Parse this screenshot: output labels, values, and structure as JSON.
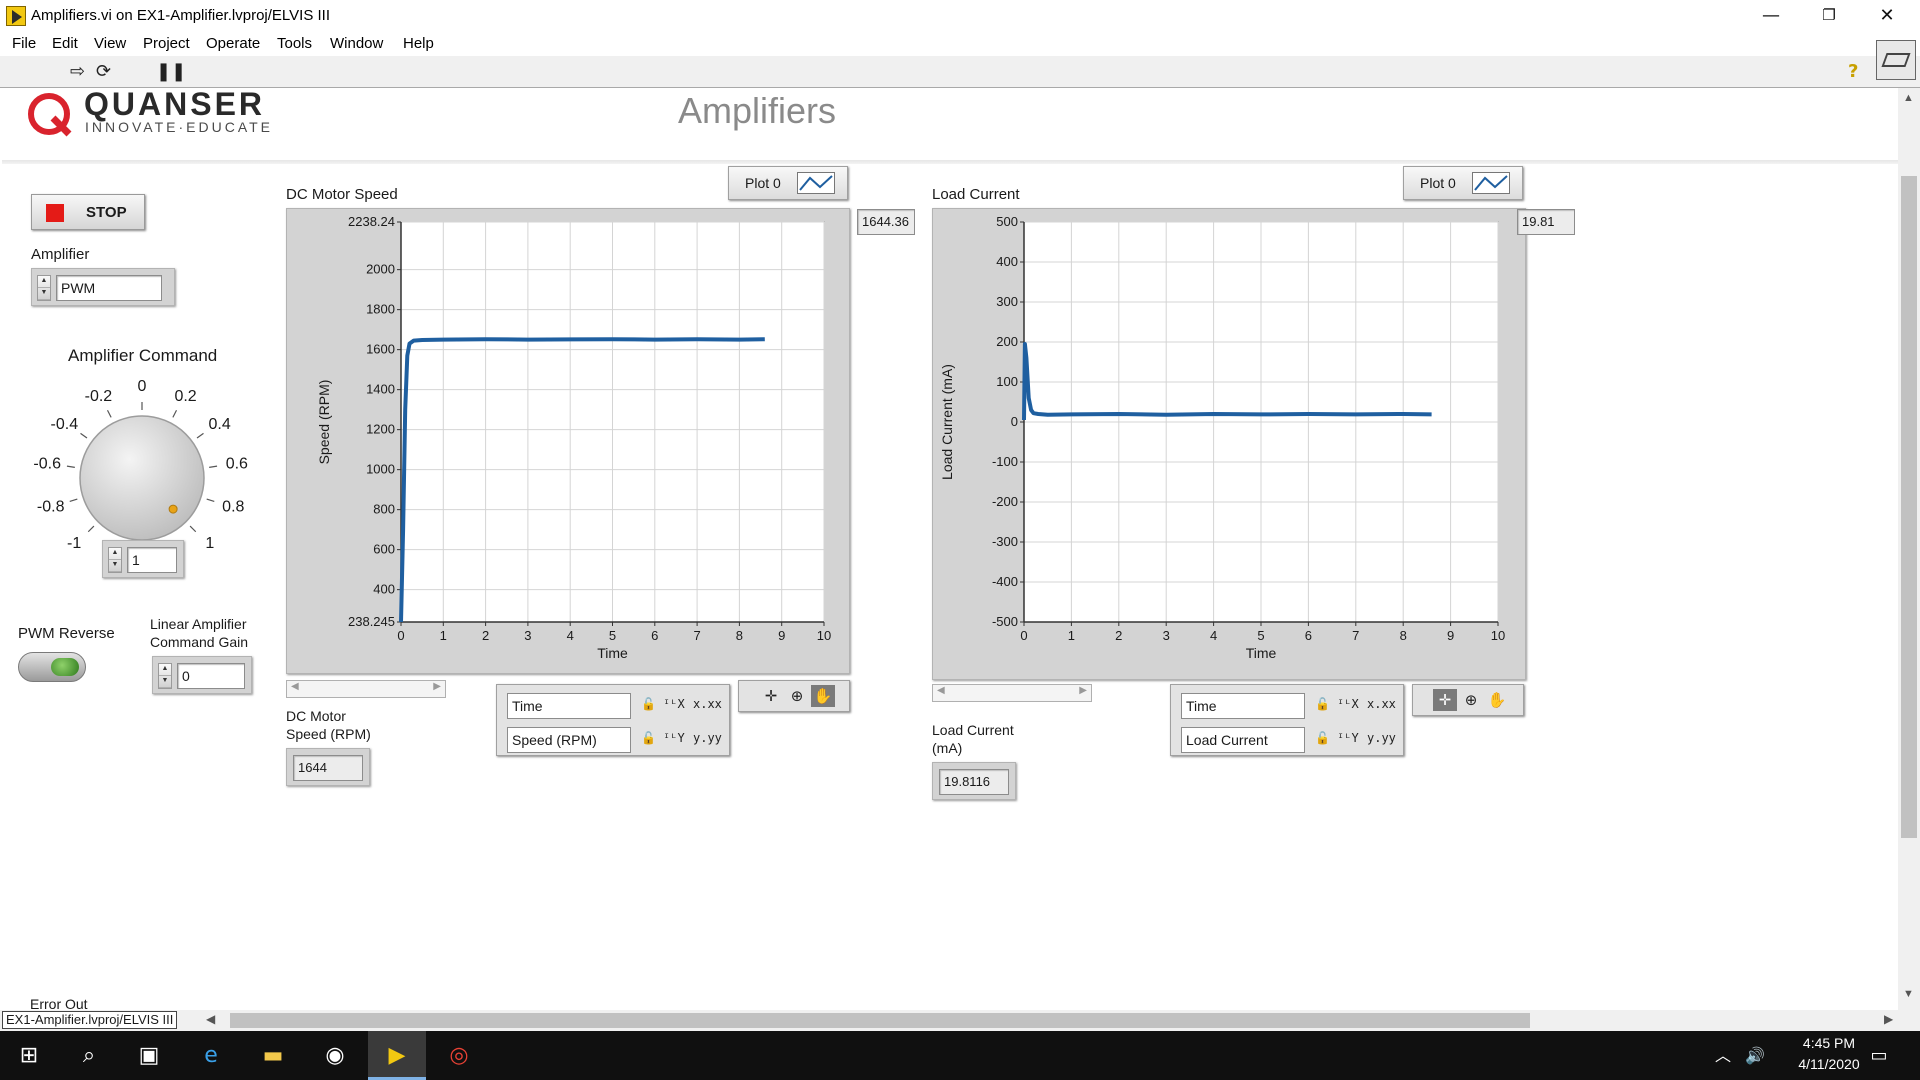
{
  "window": {
    "title": "Amplifiers.vi on EX1-Amplifier.lvproj/ELVIS III",
    "controls": {
      "minimize": "—",
      "restore": "❐",
      "close": "✕"
    }
  },
  "menu": [
    "File",
    "Edit",
    "View",
    "Project",
    "Operate",
    "Tools",
    "Window",
    "Help"
  ],
  "toolbar": {
    "run_icon": "run-arrow-icon",
    "continuous_icon": "run-continuously-icon",
    "pause_icon": "pause-icon",
    "help_icon": "context-help-icon"
  },
  "header": {
    "logo_brand": "QUANSER",
    "logo_tagline": "INNOVATE·EDUCATE",
    "title": "Amplifiers"
  },
  "controls": {
    "stop_label": "STOP",
    "amplifier_label": "Amplifier",
    "amplifier_value": "PWM",
    "command_label": "Amplifier Command",
    "command_value": "1",
    "knob_ticks": [
      "-1",
      "-0.8",
      "-0.6",
      "-0.4",
      "-0.2",
      "0",
      "0.2",
      "0.4",
      "0.6",
      "0.8",
      "1"
    ],
    "knob_value": 1,
    "pwm_reverse_label": "PWM Reverse",
    "linear_gain_label_1": "Linear Amplifier",
    "linear_gain_label_2": "Command Gain",
    "linear_gain_value": "0",
    "error_out_label": "Error Out"
  },
  "speed_chart": {
    "title": "DC Motor Speed",
    "legend_label": "Plot 0",
    "digital_display": "1644.36",
    "indicator_label_1": "DC Motor",
    "indicator_label_2": "Speed (RPM)",
    "indicator_value": "1644",
    "x_scale_name": "Time",
    "y_scale_name": "Speed (RPM)"
  },
  "current_chart": {
    "title": "Load Current",
    "legend_label": "Plot 0",
    "digital_display": "19.81",
    "indicator_label_1": "Load Current",
    "indicator_label_2": "(mA)",
    "indicator_value": "19.8116",
    "x_scale_name": "Time",
    "y_scale_name": "Load Current"
  },
  "chart_data": [
    {
      "type": "line",
      "title": "DC Motor Speed",
      "xlabel": "Time",
      "ylabel": "Speed (RPM)",
      "xlim": [
        0,
        10
      ],
      "ylim": [
        238.245,
        2238.24
      ],
      "x_ticks": [
        "0",
        "1",
        "2",
        "3",
        "4",
        "5",
        "6",
        "7",
        "8",
        "9",
        "10"
      ],
      "y_ticks": [
        {
          "value": 2238.24,
          "label": "2238.24"
        },
        {
          "value": 2000,
          "label": "2000"
        },
        {
          "value": 1800,
          "label": "1800"
        },
        {
          "value": 1600,
          "label": "1600"
        },
        {
          "value": 1400,
          "label": "1400"
        },
        {
          "value": 1200,
          "label": "1200"
        },
        {
          "value": 1000,
          "label": "1000"
        },
        {
          "value": 800,
          "label": "800"
        },
        {
          "value": 600,
          "label": "600"
        },
        {
          "value": 400,
          "label": "400"
        },
        {
          "value": 238.245,
          "label": "238.245"
        }
      ],
      "grid": true,
      "series": [
        {
          "color": "#1f5fa0",
          "x": [
            0,
            0.05,
            0.1,
            0.15,
            0.2,
            0.3,
            0.5,
            1,
            2,
            3,
            4,
            5,
            6,
            7,
            8,
            8.6
          ],
          "y": [
            238.245,
            700,
            1300,
            1570,
            1630,
            1645,
            1648,
            1650,
            1652,
            1650,
            1651,
            1652,
            1650,
            1652,
            1650,
            1652
          ]
        }
      ]
    },
    {
      "type": "line",
      "title": "Load Current",
      "xlabel": "Time",
      "ylabel": "Load Current (mA)",
      "xlim": [
        0,
        10
      ],
      "ylim": [
        -500,
        500
      ],
      "x_ticks": [
        "0",
        "1",
        "2",
        "3",
        "4",
        "5",
        "6",
        "7",
        "8",
        "9",
        "10"
      ],
      "y_ticks": [
        {
          "value": 500,
          "label": "500"
        },
        {
          "value": 400,
          "label": "400"
        },
        {
          "value": 300,
          "label": "300"
        },
        {
          "value": 200,
          "label": "200"
        },
        {
          "value": 100,
          "label": "100"
        },
        {
          "value": 0,
          "label": "0"
        },
        {
          "value": -100,
          "label": "-100"
        },
        {
          "value": -200,
          "label": "-200"
        },
        {
          "value": -300,
          "label": "-300"
        },
        {
          "value": -400,
          "label": "-400"
        },
        {
          "value": -500,
          "label": "-500"
        }
      ],
      "grid": true,
      "series": [
        {
          "color": "#1f5fa0",
          "x": [
            0,
            0.02,
            0.05,
            0.1,
            0.15,
            0.2,
            0.3,
            0.5,
            1,
            2,
            3,
            4,
            5,
            6,
            7,
            8,
            8.6
          ],
          "y": [
            5,
            195,
            160,
            60,
            30,
            22,
            20,
            18,
            19,
            20,
            18,
            20,
            19,
            20,
            19,
            20,
            19
          ]
        }
      ]
    }
  ],
  "statusbar": {
    "project_path": "EX1-Amplifier.lvproj/ELVIS III"
  },
  "taskbar": {
    "time": "4:45 PM",
    "date": "4/11/2020",
    "items": [
      "start-icon",
      "search-icon",
      "task-view-icon",
      "internet-explorer-icon",
      "file-explorer-icon",
      "app-icon",
      "labview-icon",
      "chrome-icon"
    ]
  }
}
